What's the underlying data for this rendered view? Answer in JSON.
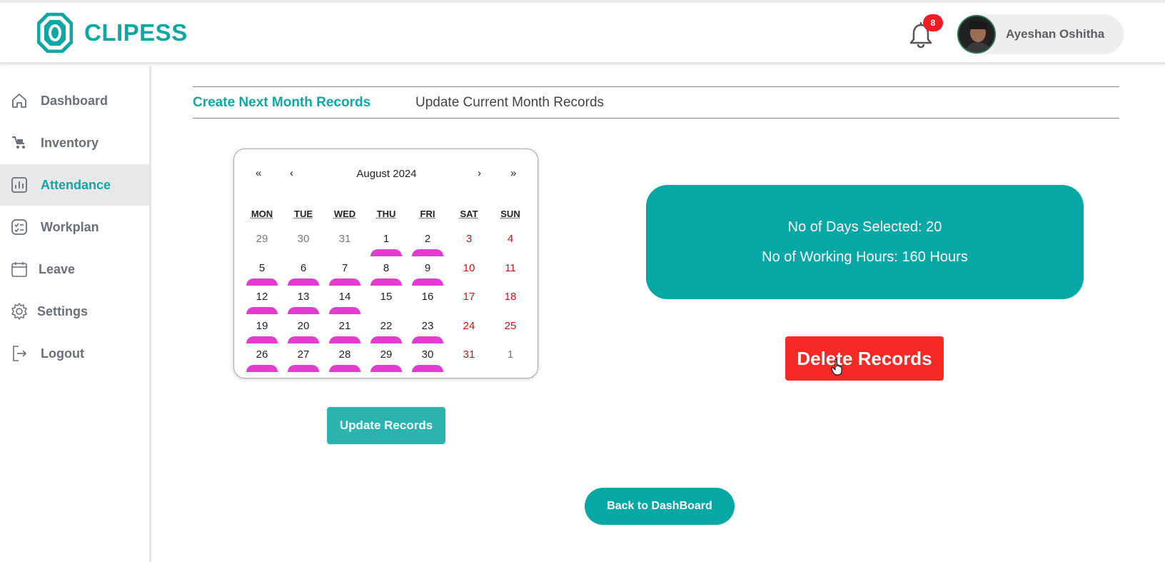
{
  "brand": {
    "name": "CLIPESS",
    "accent": "#0fa7a3"
  },
  "header": {
    "notification_count": "8",
    "user_name": "Ayeshan Oshitha"
  },
  "sidebar": {
    "items": [
      {
        "label": "Dashboard",
        "icon": "home-icon",
        "active": false
      },
      {
        "label": "Inventory",
        "icon": "inventory-icon",
        "active": false
      },
      {
        "label": "Attendance",
        "icon": "chart-icon",
        "active": true
      },
      {
        "label": "Workplan",
        "icon": "checklist-icon",
        "active": false
      },
      {
        "label": "Leave",
        "icon": "calendar-icon",
        "active": false
      },
      {
        "label": "Settings",
        "icon": "gear-icon",
        "active": false
      },
      {
        "label": "Logout",
        "icon": "logout-icon",
        "active": false
      }
    ]
  },
  "tabs": {
    "active": "Create Next Month Records",
    "inactive": "Update Current Month Records"
  },
  "calendar": {
    "nav_first": "«",
    "nav_prev": "‹",
    "nav_next": "›",
    "nav_last": "»",
    "title": "August 2024",
    "weekdays": [
      "MON",
      "TUE",
      "WED",
      "THU",
      "FRI",
      "SAT",
      "SUN"
    ],
    "weeks": [
      [
        {
          "n": "29",
          "other": true,
          "sel": false
        },
        {
          "n": "30",
          "other": true,
          "sel": false
        },
        {
          "n": "31",
          "other": true,
          "sel": false
        },
        {
          "n": "1",
          "other": false,
          "sel": true
        },
        {
          "n": "2",
          "other": false,
          "sel": true
        },
        {
          "n": "3",
          "other": false,
          "sel": false
        },
        {
          "n": "4",
          "other": false,
          "sel": false
        }
      ],
      [
        {
          "n": "5",
          "other": false,
          "sel": true
        },
        {
          "n": "6",
          "other": false,
          "sel": true
        },
        {
          "n": "7",
          "other": false,
          "sel": true
        },
        {
          "n": "8",
          "other": false,
          "sel": true
        },
        {
          "n": "9",
          "other": false,
          "sel": true
        },
        {
          "n": "10",
          "other": false,
          "sel": false
        },
        {
          "n": "11",
          "other": false,
          "sel": false
        }
      ],
      [
        {
          "n": "12",
          "other": false,
          "sel": true
        },
        {
          "n": "13",
          "other": false,
          "sel": true
        },
        {
          "n": "14",
          "other": false,
          "sel": true
        },
        {
          "n": "15",
          "other": false,
          "sel": false
        },
        {
          "n": "16",
          "other": false,
          "sel": false
        },
        {
          "n": "17",
          "other": false,
          "sel": false
        },
        {
          "n": "18",
          "other": false,
          "sel": false
        }
      ],
      [
        {
          "n": "19",
          "other": false,
          "sel": true
        },
        {
          "n": "20",
          "other": false,
          "sel": true
        },
        {
          "n": "21",
          "other": false,
          "sel": true
        },
        {
          "n": "22",
          "other": false,
          "sel": true
        },
        {
          "n": "23",
          "other": false,
          "sel": true
        },
        {
          "n": "24",
          "other": false,
          "sel": false
        },
        {
          "n": "25",
          "other": false,
          "sel": false
        }
      ],
      [
        {
          "n": "26",
          "other": false,
          "sel": true
        },
        {
          "n": "27",
          "other": false,
          "sel": true
        },
        {
          "n": "28",
          "other": false,
          "sel": true
        },
        {
          "n": "29",
          "other": false,
          "sel": true
        },
        {
          "n": "30",
          "other": false,
          "sel": true
        },
        {
          "n": "31",
          "other": false,
          "sel": false
        },
        {
          "n": "1",
          "other": true,
          "sel": false
        }
      ]
    ],
    "selected_color": "#e33bd0",
    "weekend_color": "#c0171a"
  },
  "summary": {
    "days_selected": "No of Days Selected: 20",
    "working_hours": "No of Working Hours: 160 Hours"
  },
  "buttons": {
    "delete": "Delete Records",
    "update": "Update Records",
    "back": "Back to DashBoard"
  },
  "colors": {
    "delete": "#f52a26",
    "info_box": "#06a8a6"
  }
}
